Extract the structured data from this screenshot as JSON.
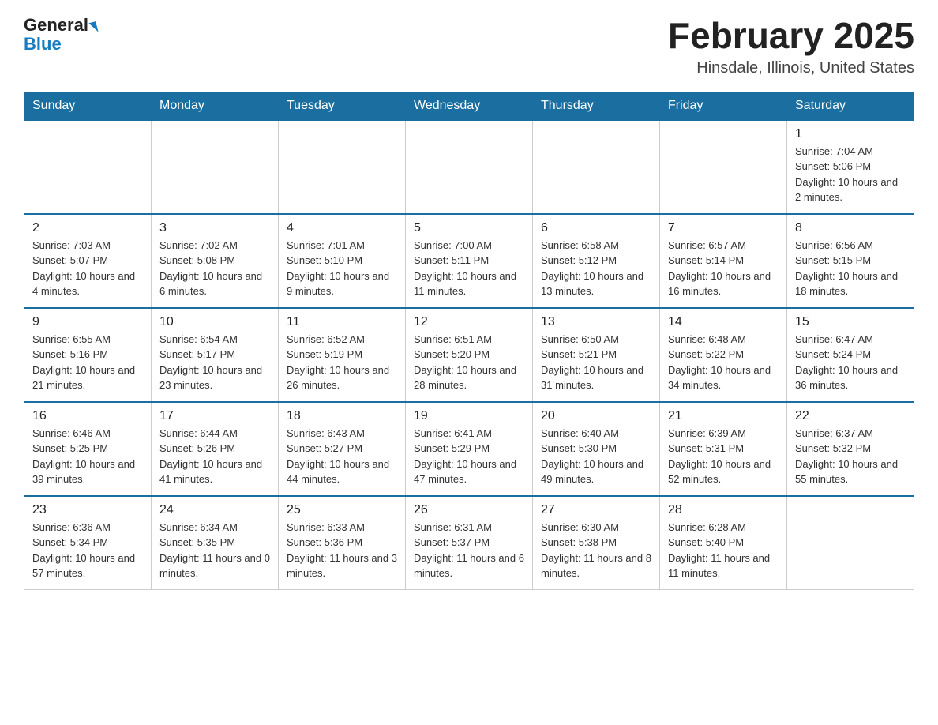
{
  "header": {
    "logo_general": "General",
    "logo_blue": "Blue",
    "month_title": "February 2025",
    "location": "Hinsdale, Illinois, United States"
  },
  "days_of_week": [
    "Sunday",
    "Monday",
    "Tuesday",
    "Wednesday",
    "Thursday",
    "Friday",
    "Saturday"
  ],
  "weeks": [
    [
      {
        "day": "",
        "info": ""
      },
      {
        "day": "",
        "info": ""
      },
      {
        "day": "",
        "info": ""
      },
      {
        "day": "",
        "info": ""
      },
      {
        "day": "",
        "info": ""
      },
      {
        "day": "",
        "info": ""
      },
      {
        "day": "1",
        "info": "Sunrise: 7:04 AM\nSunset: 5:06 PM\nDaylight: 10 hours and 2 minutes."
      }
    ],
    [
      {
        "day": "2",
        "info": "Sunrise: 7:03 AM\nSunset: 5:07 PM\nDaylight: 10 hours and 4 minutes."
      },
      {
        "day": "3",
        "info": "Sunrise: 7:02 AM\nSunset: 5:08 PM\nDaylight: 10 hours and 6 minutes."
      },
      {
        "day": "4",
        "info": "Sunrise: 7:01 AM\nSunset: 5:10 PM\nDaylight: 10 hours and 9 minutes."
      },
      {
        "day": "5",
        "info": "Sunrise: 7:00 AM\nSunset: 5:11 PM\nDaylight: 10 hours and 11 minutes."
      },
      {
        "day": "6",
        "info": "Sunrise: 6:58 AM\nSunset: 5:12 PM\nDaylight: 10 hours and 13 minutes."
      },
      {
        "day": "7",
        "info": "Sunrise: 6:57 AM\nSunset: 5:14 PM\nDaylight: 10 hours and 16 minutes."
      },
      {
        "day": "8",
        "info": "Sunrise: 6:56 AM\nSunset: 5:15 PM\nDaylight: 10 hours and 18 minutes."
      }
    ],
    [
      {
        "day": "9",
        "info": "Sunrise: 6:55 AM\nSunset: 5:16 PM\nDaylight: 10 hours and 21 minutes."
      },
      {
        "day": "10",
        "info": "Sunrise: 6:54 AM\nSunset: 5:17 PM\nDaylight: 10 hours and 23 minutes."
      },
      {
        "day": "11",
        "info": "Sunrise: 6:52 AM\nSunset: 5:19 PM\nDaylight: 10 hours and 26 minutes."
      },
      {
        "day": "12",
        "info": "Sunrise: 6:51 AM\nSunset: 5:20 PM\nDaylight: 10 hours and 28 minutes."
      },
      {
        "day": "13",
        "info": "Sunrise: 6:50 AM\nSunset: 5:21 PM\nDaylight: 10 hours and 31 minutes."
      },
      {
        "day": "14",
        "info": "Sunrise: 6:48 AM\nSunset: 5:22 PM\nDaylight: 10 hours and 34 minutes."
      },
      {
        "day": "15",
        "info": "Sunrise: 6:47 AM\nSunset: 5:24 PM\nDaylight: 10 hours and 36 minutes."
      }
    ],
    [
      {
        "day": "16",
        "info": "Sunrise: 6:46 AM\nSunset: 5:25 PM\nDaylight: 10 hours and 39 minutes."
      },
      {
        "day": "17",
        "info": "Sunrise: 6:44 AM\nSunset: 5:26 PM\nDaylight: 10 hours and 41 minutes."
      },
      {
        "day": "18",
        "info": "Sunrise: 6:43 AM\nSunset: 5:27 PM\nDaylight: 10 hours and 44 minutes."
      },
      {
        "day": "19",
        "info": "Sunrise: 6:41 AM\nSunset: 5:29 PM\nDaylight: 10 hours and 47 minutes."
      },
      {
        "day": "20",
        "info": "Sunrise: 6:40 AM\nSunset: 5:30 PM\nDaylight: 10 hours and 49 minutes."
      },
      {
        "day": "21",
        "info": "Sunrise: 6:39 AM\nSunset: 5:31 PM\nDaylight: 10 hours and 52 minutes."
      },
      {
        "day": "22",
        "info": "Sunrise: 6:37 AM\nSunset: 5:32 PM\nDaylight: 10 hours and 55 minutes."
      }
    ],
    [
      {
        "day": "23",
        "info": "Sunrise: 6:36 AM\nSunset: 5:34 PM\nDaylight: 10 hours and 57 minutes."
      },
      {
        "day": "24",
        "info": "Sunrise: 6:34 AM\nSunset: 5:35 PM\nDaylight: 11 hours and 0 minutes."
      },
      {
        "day": "25",
        "info": "Sunrise: 6:33 AM\nSunset: 5:36 PM\nDaylight: 11 hours and 3 minutes."
      },
      {
        "day": "26",
        "info": "Sunrise: 6:31 AM\nSunset: 5:37 PM\nDaylight: 11 hours and 6 minutes."
      },
      {
        "day": "27",
        "info": "Sunrise: 6:30 AM\nSunset: 5:38 PM\nDaylight: 11 hours and 8 minutes."
      },
      {
        "day": "28",
        "info": "Sunrise: 6:28 AM\nSunset: 5:40 PM\nDaylight: 11 hours and 11 minutes."
      },
      {
        "day": "",
        "info": ""
      }
    ]
  ]
}
